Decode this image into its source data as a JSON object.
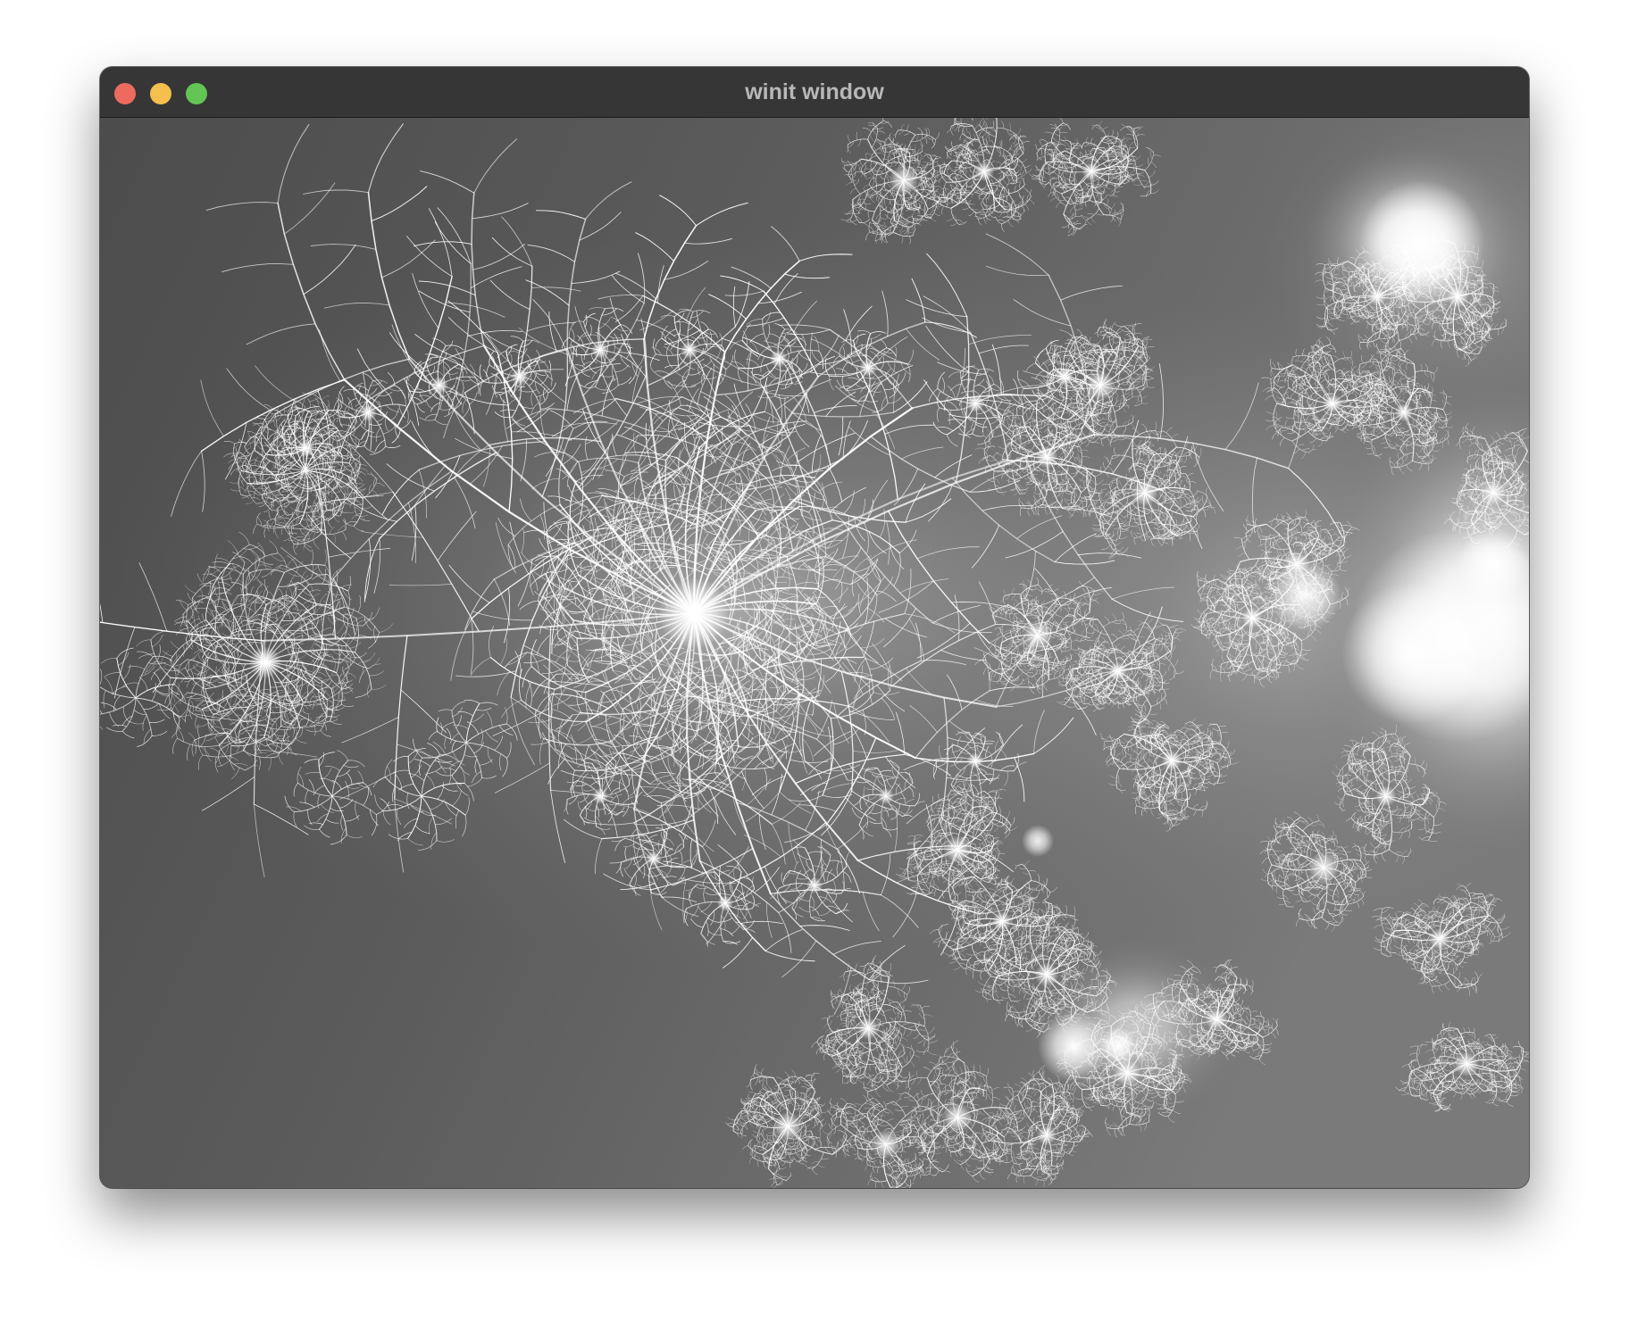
{
  "window": {
    "title": "winit window"
  },
  "titlebar_buttons": {
    "close_color": "#ed6a5e",
    "minimize_color": "#f5bf4f",
    "maximize_color": "#62c554"
  },
  "canvas": {
    "content": "mandelbrot-fractal-render",
    "background_dark": "#4a4a4a",
    "glow_color": "#9a9a9a",
    "filament_color": "#ffffff"
  }
}
